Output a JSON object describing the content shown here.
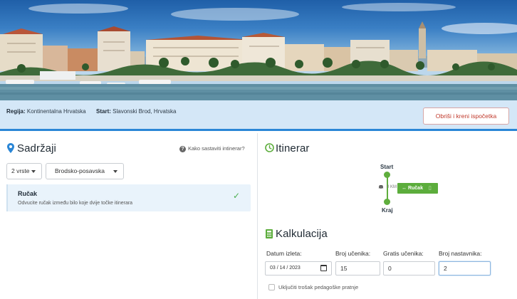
{
  "header": {
    "region_label": "Regija:",
    "region_value": "Kontinentalna Hrvatska",
    "start_label": "Start:",
    "start_value": "Slavonski Brod, Hrvatska",
    "restart_button": "Obriši i kreni ispočetka"
  },
  "content": {
    "title": "Sadržaji",
    "help_link": "Kako sastaviti intinerar?",
    "filter_count": "2 vrste",
    "filter_county": "Brodsko-posavska",
    "activities": [
      {
        "title": "Ručak",
        "description": "Odvucite ručak između bilo koje dvije točke itinerara",
        "selected": true
      }
    ]
  },
  "itinerary": {
    "title": "Itinerar",
    "start": "Start",
    "end": "Kraj",
    "distance": "0 KM",
    "stop_tag": "Ručak"
  },
  "calculation": {
    "title": "Kalkulacija",
    "date_label": "Datum izleta:",
    "date_value": "03 / 14 / 2023",
    "students_label": "Broj učenika:",
    "students_value": "15",
    "free_students_label": "Gratis učenika:",
    "free_students_value": "0",
    "teachers_label": "Broj nastavnika:",
    "teachers_value": "2",
    "escort_cost_label": "Uključiti trošak pedagoške pratnje"
  },
  "colors": {
    "accent_blue": "#2a86d6",
    "info_bar": "#d4e7f7",
    "green": "#5cad3c",
    "danger": "#c0392b"
  },
  "icons": {
    "content": "location-pin-icon",
    "itinerary": "clock-icon",
    "calculation": "calculator-icon",
    "help": "question-circle-icon",
    "check": "checkmark-icon",
    "car": "car-icon",
    "calendar": "calendar-icon"
  }
}
